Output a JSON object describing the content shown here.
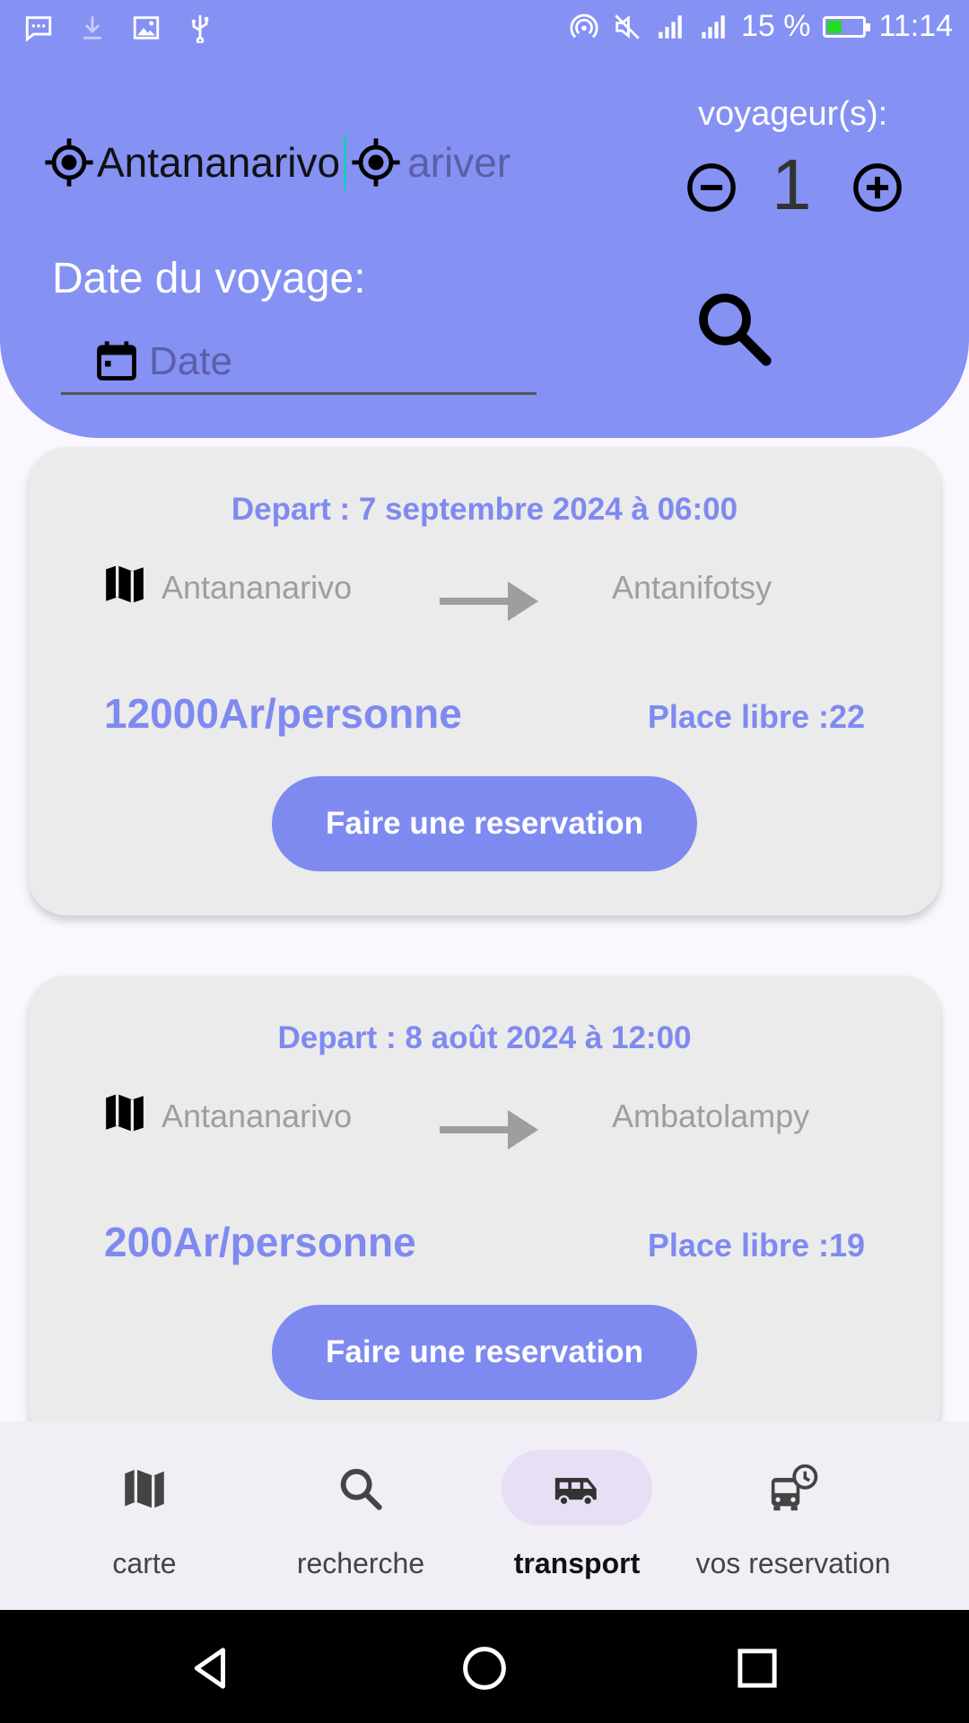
{
  "status_bar": {
    "battery_percent": "15 %",
    "time": "11:14",
    "battery_level": 0.15,
    "battery_color": "#22dd22"
  },
  "search": {
    "origin_value": "Antananarivo",
    "destination_placeholder": "ariver",
    "travelers_label": "voyageur(s):",
    "travelers_count": "1",
    "date_label": "Date du voyage:",
    "date_placeholder": "Date"
  },
  "trips": [
    {
      "depart": "Depart : 7 septembre 2024 à 06:00",
      "from": "Antananarivo",
      "to": "Antanifotsy",
      "price": "12000Ar/personne",
      "places": "Place libre :22",
      "reserve_label": "Faire une reservation"
    },
    {
      "depart": "Depart : 8 août 2024 à 12:00",
      "from": "Antananarivo",
      "to": "Ambatolampy",
      "price": "200Ar/personne",
      "places": "Place libre :19",
      "reserve_label": "Faire une reservation"
    }
  ],
  "bottom_nav": {
    "items": [
      {
        "label": "carte",
        "icon": "map-icon"
      },
      {
        "label": "recherche",
        "icon": "search-icon"
      },
      {
        "label": "transport",
        "icon": "van-icon",
        "active": true
      },
      {
        "label": "vos reservation",
        "icon": "bus-clock-icon"
      }
    ]
  },
  "colors": {
    "header": "#8591f3",
    "accent": "#7f8af0",
    "card": "#ebebeb",
    "nav_active_pill": "#e6dff5"
  }
}
